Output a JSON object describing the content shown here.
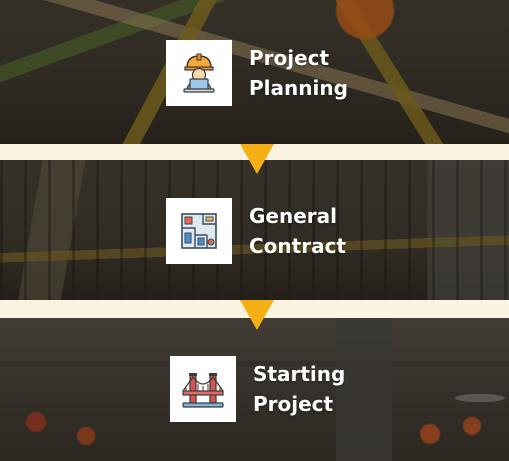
{
  "steps": [
    {
      "line1": "Project",
      "line2": "Planning",
      "icon": "engineer-laptop-icon"
    },
    {
      "line1": "General",
      "line2": "Contract",
      "icon": "blueprint-floorplan-icon"
    },
    {
      "line1": "Starting",
      "line2": "Project",
      "icon": "bridge-icon"
    }
  ],
  "colors": {
    "arrow": "#f5b015",
    "band": "#fbf3e2",
    "label": "#ffffff",
    "icon_box": "#ffffff"
  }
}
